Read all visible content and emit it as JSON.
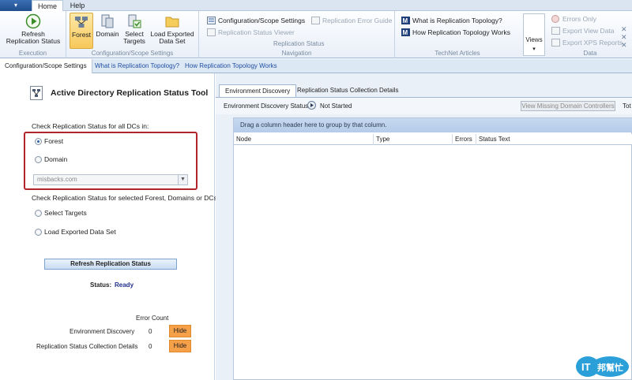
{
  "ribbon_tabs": {
    "app_menu": "▾",
    "home": "Home",
    "help": "Help"
  },
  "ribbon": {
    "execution": {
      "refresh_label_1": "Refresh",
      "refresh_label_2": "Replication Status",
      "group": "Execution"
    },
    "scope": {
      "forest": "Forest",
      "domain": "Domain",
      "select_1": "Select",
      "select_2": "Targets",
      "load_1": "Load Exported",
      "load_2": "Data Set",
      "group": "Configuration/Scope Settings"
    },
    "navigation": {
      "config_scope": "Configuration/Scope Settings",
      "status_viewer": "Replication Status Viewer",
      "error_guide": "Replication Error Guide",
      "sub_group": "Replication Status",
      "group": "Navigation"
    },
    "technet": {
      "what_is": "What is Replication Topology?",
      "how_works": "How Replication Topology Works",
      "group": "TechNet Articles"
    },
    "views": {
      "label": "Views"
    },
    "data": {
      "errors_only": "Errors Only",
      "export_view": "Export View Data",
      "export_xps": "Export XPS Reports",
      "group": "Data"
    }
  },
  "links": {
    "config": "Configuration/Scope Settings",
    "what_is": "What is Replication Topology?",
    "how_works": "How Replication Topology Works"
  },
  "left": {
    "title": "Active Directory Replication Status Tool",
    "check_all_label": "Check Replication Status for all DCs in:",
    "forest": "Forest",
    "domain": "Domain",
    "domain_value": "misbacks.com",
    "check_selected_label": "Check Replication Status for selected Forest, Domains or DCs:",
    "select_targets": "Select Targets",
    "load_exported": "Load Exported Data Set",
    "refresh_button": "Refresh Replication Status",
    "status_label": "Status:",
    "status_value": "Ready",
    "error_count_header": "Error Count",
    "rows": [
      {
        "name": "Environment Discovery",
        "count": "0",
        "button": "Hide"
      },
      {
        "name": "Replication Status Collection Details",
        "count": "0",
        "button": "Hide"
      }
    ]
  },
  "right": {
    "tab_env": "Environment Discovery",
    "tab_coll": "Replication Status Collection Details",
    "env_status_label": "Environment Discovery Status:",
    "env_status_value": "Not Started",
    "view_missing": "View Missing Domain Controllers",
    "total_cut": "Tot",
    "group_hint": "Drag a column header here to group by that column.",
    "columns": [
      "Node",
      "Type",
      "Errors",
      "Status Text"
    ]
  },
  "watermark": {
    "text_1": "IT",
    "text_2": "邦幫忙"
  },
  "colors": {
    "accent": "#1f4ea0",
    "highlight_box": "#b4252b",
    "hide_button": "#f6a04a",
    "status_ready": "#1e2f8a"
  }
}
